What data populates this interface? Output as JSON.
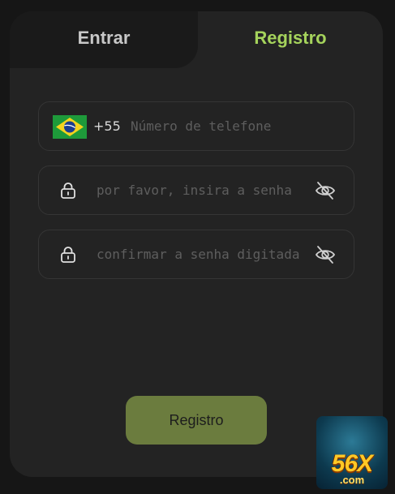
{
  "tabs": {
    "login_label": "Entrar",
    "register_label": "Registro"
  },
  "phone_field": {
    "country_flag": "brazil-flag-icon",
    "country_code": "+55",
    "placeholder": "Número de telefone"
  },
  "password_field": {
    "placeholder": "por favor, insira a senha"
  },
  "confirm_password_field": {
    "placeholder": "confirmar a senha digitada"
  },
  "submit_label": "Registro",
  "brand": {
    "logo_text": "56X",
    "logo_subtext": ".com"
  },
  "colors": {
    "accent": "#a5d35c",
    "button": "#6b7c3e",
    "card": "#232323",
    "background": "#161616"
  }
}
